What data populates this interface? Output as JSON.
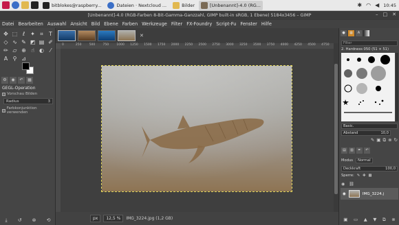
{
  "taskbar": {
    "tasks": [
      {
        "label": "bitblokes@raspberry..."
      },
      {
        "label": "Dateien · Nextcloud ..."
      },
      {
        "label": "Bilder"
      },
      {
        "label": "[Unbenannt]-4.0 (RG..."
      }
    ],
    "clock": "10:45"
  },
  "window": {
    "title": "[Unbenannt]-4.0 (RGB-Farben 8-Bit-Gamma-Ganzzahl, GIMP built-in sRGB, 1 Ebene) 5184x3456 – GIMP"
  },
  "menu": [
    "Datei",
    "Bearbeiten",
    "Auswahl",
    "Ansicht",
    "Bild",
    "Ebene",
    "Farben",
    "Werkzeuge",
    "Filter",
    "FX-Foundry",
    "Script-Fu",
    "Fenster",
    "Hilfe"
  ],
  "tool_options": {
    "title": "GEGL-Operation",
    "option1": "Vorschau Bilden",
    "radius_label": "Radius",
    "radius_value": "3",
    "option2": "Farbkonjunktion verwenden"
  },
  "rulers": {
    "top": [
      "0",
      "250",
      "500",
      "750",
      "1000",
      "1250",
      "1500",
      "1750",
      "2000",
      "2250",
      "2500",
      "2750",
      "3000",
      "3250",
      "3500",
      "3750",
      "4000",
      "4250",
      "4500",
      "4750"
    ]
  },
  "status": {
    "unit": "px",
    "zoom": "12,5 %",
    "file": "IMG_3224.jpg (1,2 GB)"
  },
  "brushes": {
    "filter_placeholder": "Filter",
    "current": "2. Hardness 050 (51 × 51)",
    "preset": "Basic.",
    "spacing_label": "Abstand",
    "spacing_value": "10,0"
  },
  "layers": {
    "mode_label": "Modus",
    "mode_value": "Normal",
    "opacity_label": "Deckkraft",
    "opacity_value": "100,0",
    "lock_label": "Sperre:",
    "layer_name": "IMG_3224.j"
  },
  "colors": {
    "foreground": "#000000",
    "background": "#ffffff",
    "selection": "#e3d65a"
  }
}
